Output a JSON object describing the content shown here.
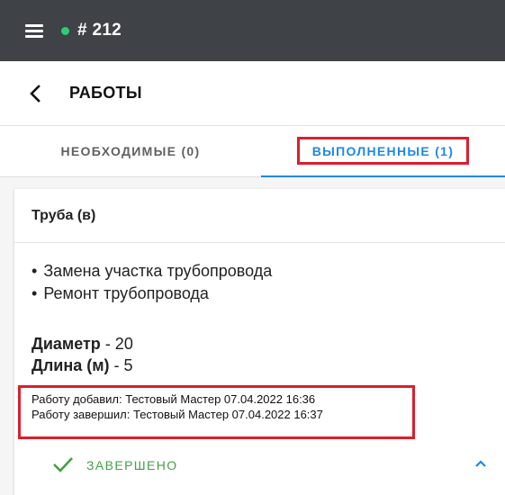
{
  "appbar": {
    "menu_icon": "menu-icon",
    "status_color": "#2ecc71",
    "order_number": "# 212",
    "background": "#3f4247"
  },
  "header": {
    "back_icon": "chevron-left-icon",
    "title": "РАБОТЫ"
  },
  "tabs": [
    {
      "label": "НЕОБХОДИМЫЕ (0)",
      "selected": false
    },
    {
      "label": "ВЫПОЛНЕННЫЕ (1)",
      "selected": true
    }
  ],
  "colors": {
    "accent": "#1e88e5",
    "highlight": "#dc1e2b",
    "success": "#43a047"
  },
  "card": {
    "title": "Труба (в)",
    "works": [
      "Замена участка трубопровода",
      "Ремонт трубопровода"
    ],
    "properties": [
      {
        "name": "Диаметр",
        "value": " - 20"
      },
      {
        "name": "Длина (м)",
        "value": " - 5"
      }
    ],
    "log": {
      "added": "Работу добавил: Тестовый Мастер 07.04.2022 16:36",
      "completed": "Работу завершил: Тестовый Мастер 07.04.2022 16:37"
    },
    "status": {
      "icon": "check-icon",
      "label": "ЗАВЕРШЕНО"
    },
    "expand_icon": "chevron-up-icon"
  }
}
